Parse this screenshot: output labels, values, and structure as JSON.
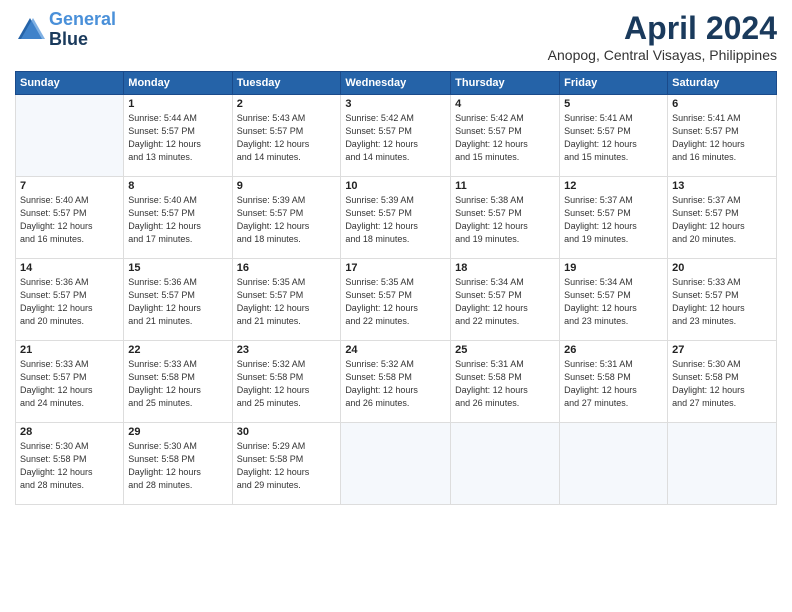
{
  "logo": {
    "line1": "General",
    "line2": "Blue"
  },
  "title": "April 2024",
  "subtitle": "Anopog, Central Visayas, Philippines",
  "days_of_week": [
    "Sunday",
    "Monday",
    "Tuesday",
    "Wednesday",
    "Thursday",
    "Friday",
    "Saturday"
  ],
  "weeks": [
    [
      {
        "day": "",
        "info": ""
      },
      {
        "day": "1",
        "info": "Sunrise: 5:44 AM\nSunset: 5:57 PM\nDaylight: 12 hours\nand 13 minutes."
      },
      {
        "day": "2",
        "info": "Sunrise: 5:43 AM\nSunset: 5:57 PM\nDaylight: 12 hours\nand 14 minutes."
      },
      {
        "day": "3",
        "info": "Sunrise: 5:42 AM\nSunset: 5:57 PM\nDaylight: 12 hours\nand 14 minutes."
      },
      {
        "day": "4",
        "info": "Sunrise: 5:42 AM\nSunset: 5:57 PM\nDaylight: 12 hours\nand 15 minutes."
      },
      {
        "day": "5",
        "info": "Sunrise: 5:41 AM\nSunset: 5:57 PM\nDaylight: 12 hours\nand 15 minutes."
      },
      {
        "day": "6",
        "info": "Sunrise: 5:41 AM\nSunset: 5:57 PM\nDaylight: 12 hours\nand 16 minutes."
      }
    ],
    [
      {
        "day": "7",
        "info": "Sunrise: 5:40 AM\nSunset: 5:57 PM\nDaylight: 12 hours\nand 16 minutes."
      },
      {
        "day": "8",
        "info": "Sunrise: 5:40 AM\nSunset: 5:57 PM\nDaylight: 12 hours\nand 17 minutes."
      },
      {
        "day": "9",
        "info": "Sunrise: 5:39 AM\nSunset: 5:57 PM\nDaylight: 12 hours\nand 18 minutes."
      },
      {
        "day": "10",
        "info": "Sunrise: 5:39 AM\nSunset: 5:57 PM\nDaylight: 12 hours\nand 18 minutes."
      },
      {
        "day": "11",
        "info": "Sunrise: 5:38 AM\nSunset: 5:57 PM\nDaylight: 12 hours\nand 19 minutes."
      },
      {
        "day": "12",
        "info": "Sunrise: 5:37 AM\nSunset: 5:57 PM\nDaylight: 12 hours\nand 19 minutes."
      },
      {
        "day": "13",
        "info": "Sunrise: 5:37 AM\nSunset: 5:57 PM\nDaylight: 12 hours\nand 20 minutes."
      }
    ],
    [
      {
        "day": "14",
        "info": "Sunrise: 5:36 AM\nSunset: 5:57 PM\nDaylight: 12 hours\nand 20 minutes."
      },
      {
        "day": "15",
        "info": "Sunrise: 5:36 AM\nSunset: 5:57 PM\nDaylight: 12 hours\nand 21 minutes."
      },
      {
        "day": "16",
        "info": "Sunrise: 5:35 AM\nSunset: 5:57 PM\nDaylight: 12 hours\nand 21 minutes."
      },
      {
        "day": "17",
        "info": "Sunrise: 5:35 AM\nSunset: 5:57 PM\nDaylight: 12 hours\nand 22 minutes."
      },
      {
        "day": "18",
        "info": "Sunrise: 5:34 AM\nSunset: 5:57 PM\nDaylight: 12 hours\nand 22 minutes."
      },
      {
        "day": "19",
        "info": "Sunrise: 5:34 AM\nSunset: 5:57 PM\nDaylight: 12 hours\nand 23 minutes."
      },
      {
        "day": "20",
        "info": "Sunrise: 5:33 AM\nSunset: 5:57 PM\nDaylight: 12 hours\nand 23 minutes."
      }
    ],
    [
      {
        "day": "21",
        "info": "Sunrise: 5:33 AM\nSunset: 5:57 PM\nDaylight: 12 hours\nand 24 minutes."
      },
      {
        "day": "22",
        "info": "Sunrise: 5:33 AM\nSunset: 5:58 PM\nDaylight: 12 hours\nand 25 minutes."
      },
      {
        "day": "23",
        "info": "Sunrise: 5:32 AM\nSunset: 5:58 PM\nDaylight: 12 hours\nand 25 minutes."
      },
      {
        "day": "24",
        "info": "Sunrise: 5:32 AM\nSunset: 5:58 PM\nDaylight: 12 hours\nand 26 minutes."
      },
      {
        "day": "25",
        "info": "Sunrise: 5:31 AM\nSunset: 5:58 PM\nDaylight: 12 hours\nand 26 minutes."
      },
      {
        "day": "26",
        "info": "Sunrise: 5:31 AM\nSunset: 5:58 PM\nDaylight: 12 hours\nand 27 minutes."
      },
      {
        "day": "27",
        "info": "Sunrise: 5:30 AM\nSunset: 5:58 PM\nDaylight: 12 hours\nand 27 minutes."
      }
    ],
    [
      {
        "day": "28",
        "info": "Sunrise: 5:30 AM\nSunset: 5:58 PM\nDaylight: 12 hours\nand 28 minutes."
      },
      {
        "day": "29",
        "info": "Sunrise: 5:30 AM\nSunset: 5:58 PM\nDaylight: 12 hours\nand 28 minutes."
      },
      {
        "day": "30",
        "info": "Sunrise: 5:29 AM\nSunset: 5:58 PM\nDaylight: 12 hours\nand 29 minutes."
      },
      {
        "day": "",
        "info": ""
      },
      {
        "day": "",
        "info": ""
      },
      {
        "day": "",
        "info": ""
      },
      {
        "day": "",
        "info": ""
      }
    ]
  ]
}
